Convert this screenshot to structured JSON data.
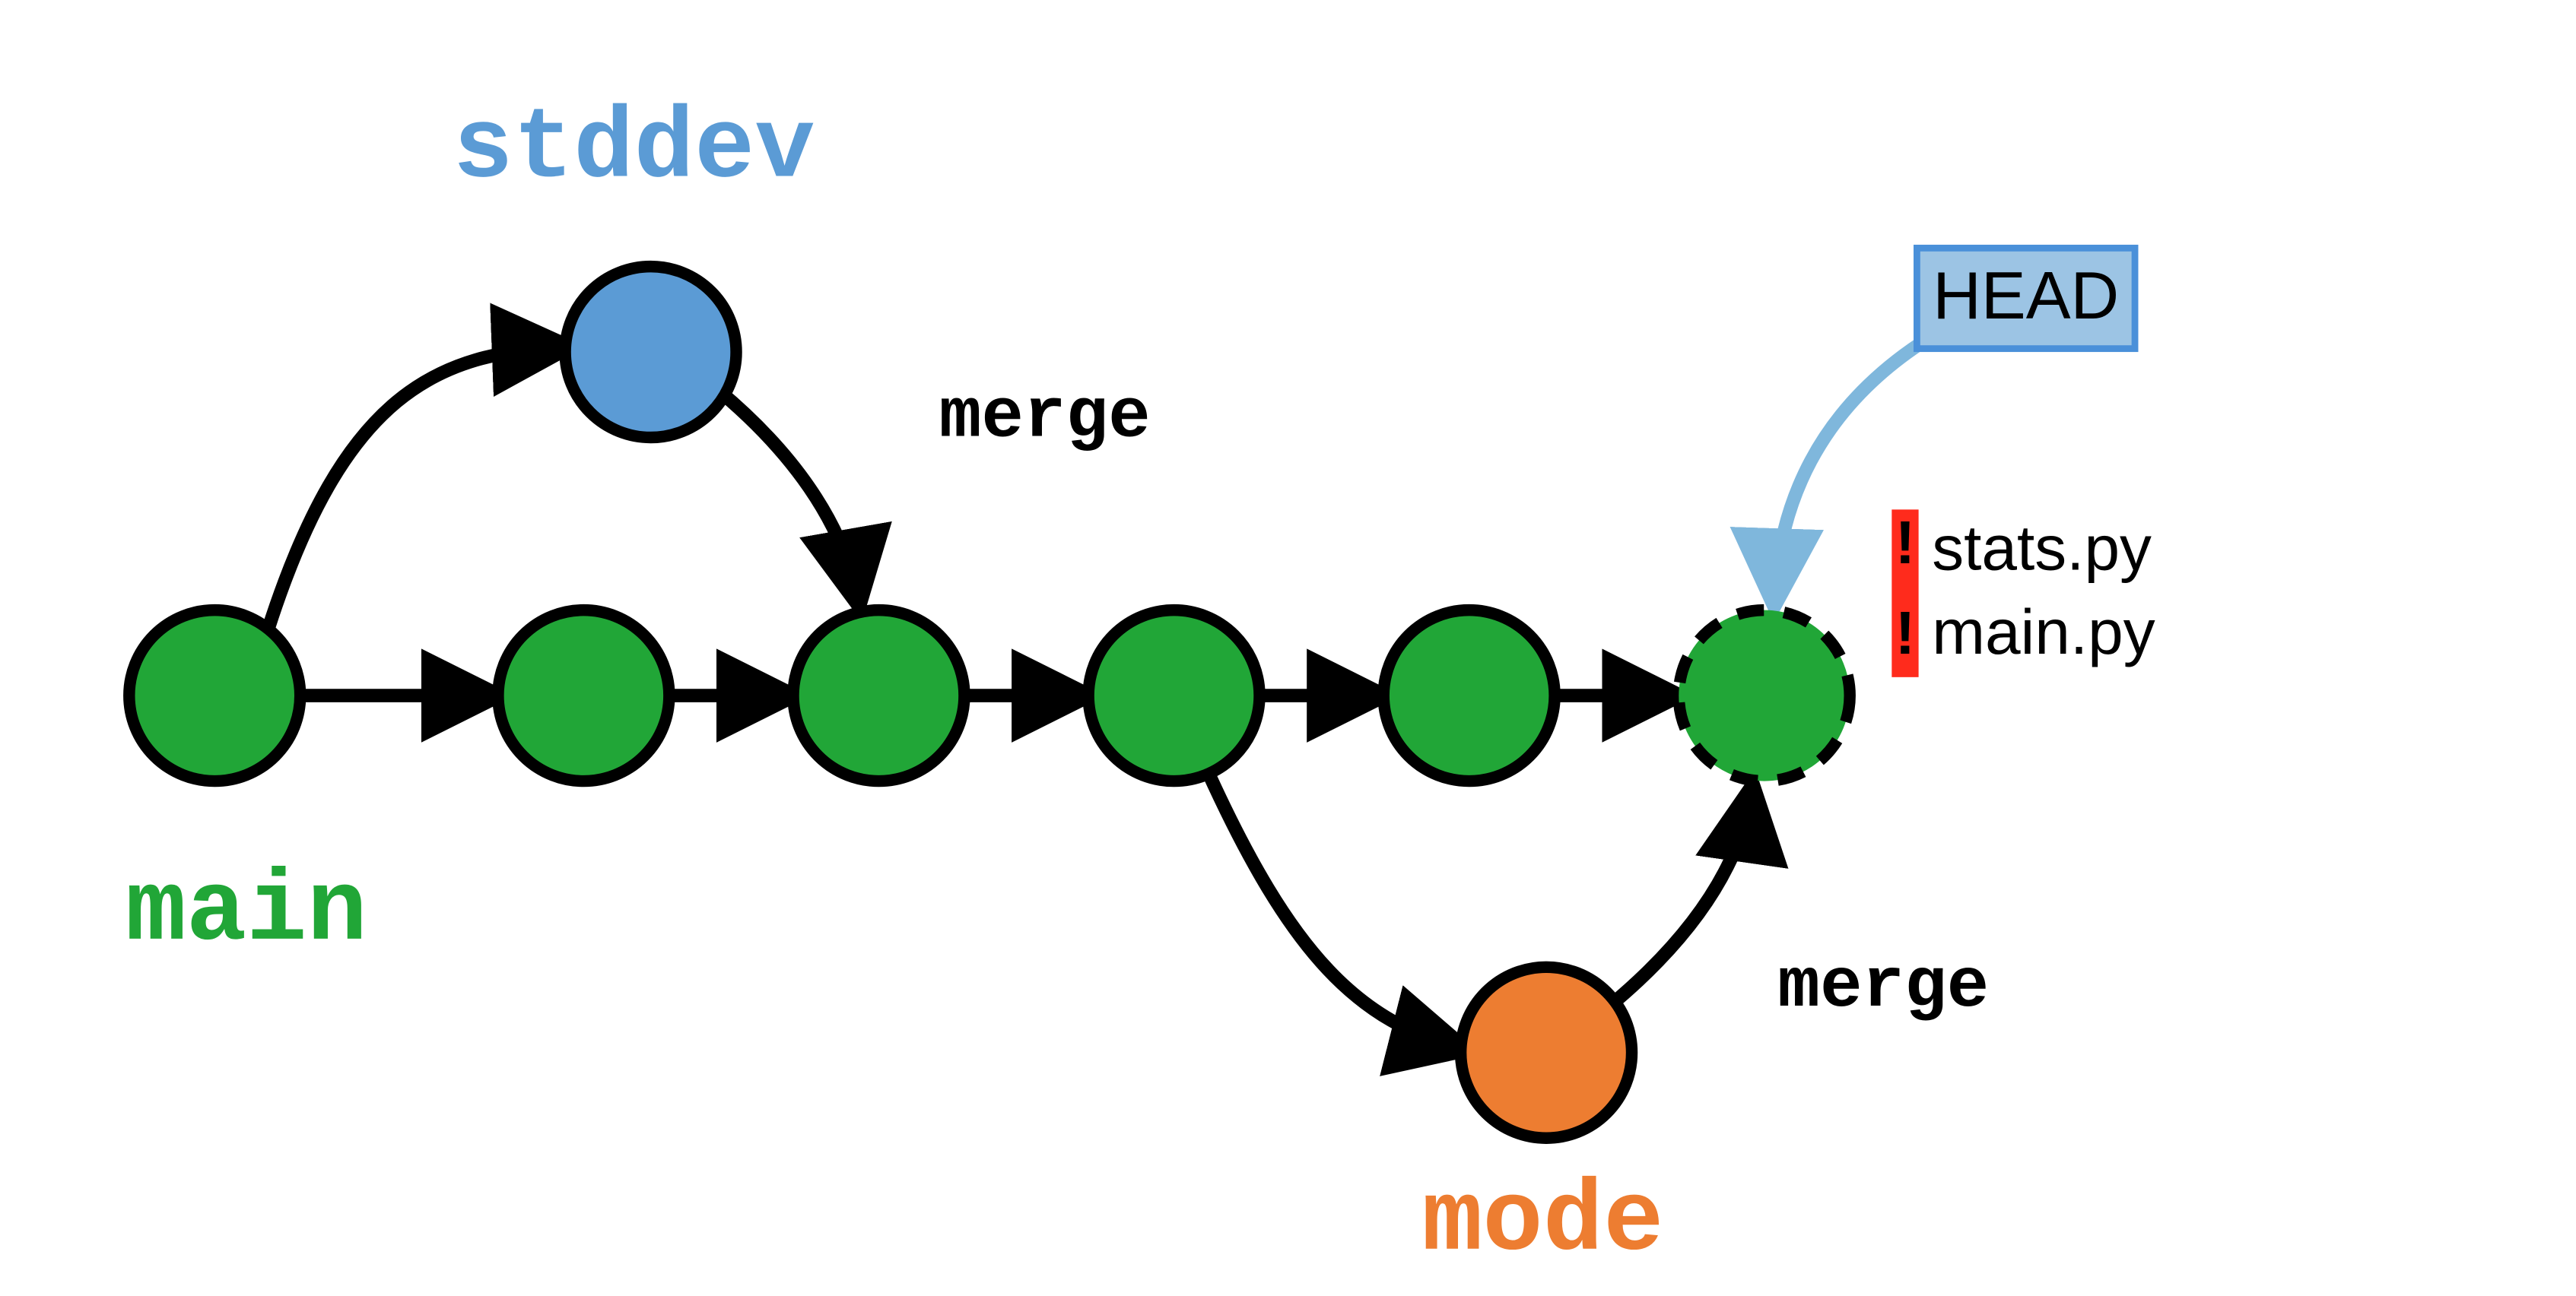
{
  "branches": {
    "main": {
      "label": "main",
      "color": "#21A637"
    },
    "stddev": {
      "label": "stddev",
      "color": "#5B9BD5"
    },
    "mode": {
      "label": "mode",
      "color": "#ED7D31"
    }
  },
  "merge_labels": {
    "stddev_merge": "merge",
    "mode_merge": "merge"
  },
  "head": {
    "label": "HEAD"
  },
  "conflict": {
    "marks": [
      "!",
      "!"
    ],
    "files": [
      "stats.py",
      "main.py"
    ]
  },
  "colors": {
    "stroke": "#000000",
    "head_box_fill": "#9CC4E4",
    "head_box_stroke": "#4A90D9",
    "head_arrow": "#7FB7DC",
    "conflict_red": "#FF2B1C",
    "working_fill": "#21A637"
  },
  "layout_note": "Git history diagram: main branch with 5 commits, stddev branch (1 commit) merged after commit 2, mode branch (1 commit) merged into working copy (dashed). HEAD points to working copy which has conflicts in stats.py and main.py."
}
